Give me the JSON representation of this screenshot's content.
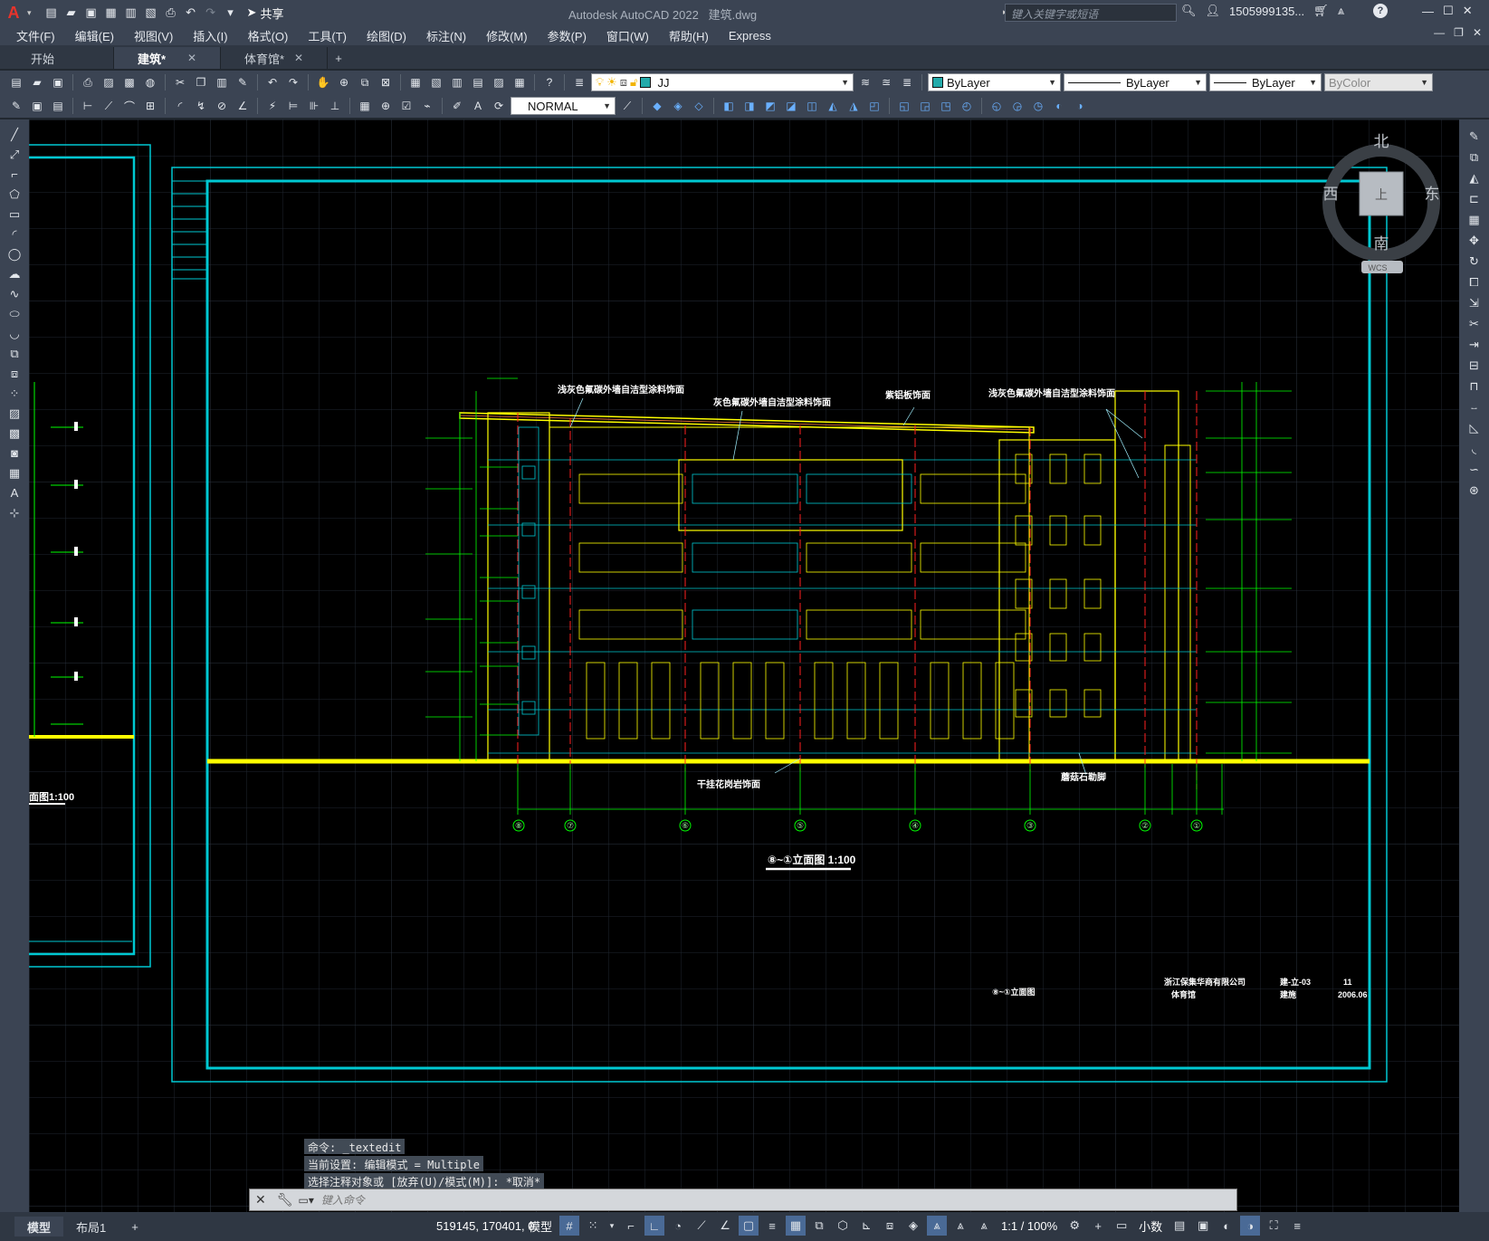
{
  "app": {
    "title": "Autodesk AutoCAD 2022",
    "file": "建筑.dwg",
    "search_placeholder": "键入关键字或短语",
    "user": "1505999135...",
    "share": "共享",
    "logo": "A"
  },
  "menu": [
    "文件(F)",
    "编辑(E)",
    "视图(V)",
    "插入(I)",
    "格式(O)",
    "工具(T)",
    "绘图(D)",
    "标注(N)",
    "修改(M)",
    "参数(P)",
    "窗口(W)",
    "帮助(H)",
    "Express"
  ],
  "tabs": [
    {
      "label": "开始"
    },
    {
      "label": "建筑*"
    },
    {
      "label": "体育馆*"
    }
  ],
  "toolbar": {
    "layer_name": "JJ",
    "color": "ByLayer",
    "linetype": "ByLayer",
    "lineweight": "ByLayer",
    "plotstyle": "ByColor",
    "text_style": "NORMAL"
  },
  "viewcube": {
    "north": "北",
    "south": "南",
    "east": "东",
    "west": "西",
    "face": "上",
    "wcs": "WCS"
  },
  "drawing": {
    "annotations": [
      "浅灰色氟碳外墙自洁型涂料饰面",
      "灰色氟碳外墙自洁型涂料饰面",
      "紫铝板饰面",
      "浅灰色氟碳外墙自洁型涂料饰面",
      "干挂花岗岩饰面",
      "蘑菇石勒脚"
    ],
    "axis_labels": [
      "⑧",
      "⑦",
      "⑥",
      "⑤",
      "④",
      "③",
      "②",
      "①"
    ],
    "elevation_title": "⑧~①立面图 1:100",
    "left_sheet_title": "面图1:100",
    "titleblock": {
      "company": "浙江保集华商有限公司",
      "project": "体育馆",
      "drawing": "⑧~①立面图",
      "sheet_no": "11",
      "sheet_code": "建-立-03",
      "date": "2006.06",
      "stage": "建施"
    }
  },
  "command": {
    "history": [
      "命令: _textedit",
      "当前设置: 编辑模式 = Multiple",
      "选择注释对象或 [放弃(U)/模式(M)]: *取消*"
    ],
    "placeholder": "键入命令"
  },
  "status": {
    "tabs": [
      "模型",
      "布局1"
    ],
    "coords": "519145, 170401, 0",
    "model": "模型",
    "scale": "1:1 / 100%",
    "units": "小数"
  }
}
